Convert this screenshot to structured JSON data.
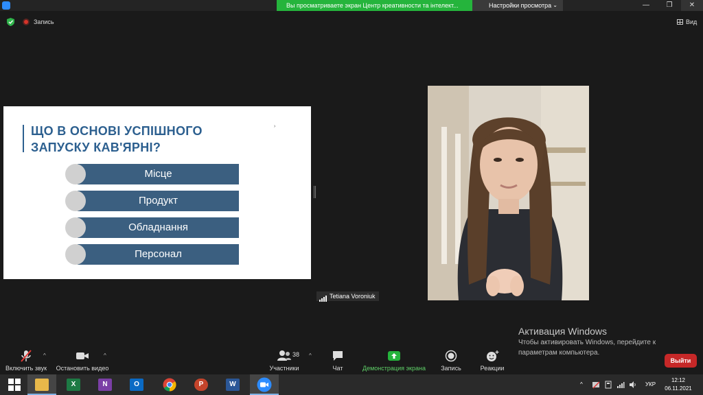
{
  "window": {
    "sharing_banner": "Вы просматриваете экран Центр креативности та інтелект...",
    "view_options_label": "Настройки просмотра",
    "minimize": "—",
    "maximize": "❐",
    "close": "✕"
  },
  "meeting_top": {
    "recording_label": "Запись",
    "view_label": "Вид"
  },
  "slide": {
    "title_line1": "ЩО В ОСНОВІ УСПІШНОГО",
    "title_line2": "ЗАПУСКУ КАВ'ЯРНІ?",
    "arrow": "›",
    "items": [
      "Місце",
      "Продукт",
      "Обладнання",
      "Персонал"
    ]
  },
  "participant": {
    "name": "Tetiana Voroniuk"
  },
  "activation": {
    "title": "Активация Windows",
    "text": "Чтобы активировать Windows, перейдите к параметрам компьютера."
  },
  "controls": {
    "mute_label": "Включить звук",
    "video_label": "Остановить видео",
    "participants_label": "Участники",
    "participants_count": "38",
    "chat_label": "Чат",
    "share_label": "Демонстрация экрана",
    "record_label": "Запись",
    "reactions_label": "Реакции",
    "leave_label": "Выйти",
    "caret": "^"
  },
  "taskbar": {
    "apps": [
      "windows-start",
      "file-explorer",
      "excel",
      "onenote",
      "outlook",
      "chrome",
      "powerpoint",
      "word",
      "zoom"
    ],
    "tile_letters": {
      "excel": "X",
      "onenote": "N",
      "outlook": "O",
      "powerpoint": "P",
      "word": "W"
    },
    "language": "УКР",
    "time": "12:12",
    "date": "06.11.2021",
    "tray_caret": "^"
  },
  "colors": {
    "share_green": "#25b43c",
    "slide_title": "#2c5f8f",
    "slide_bar": "#3b5f80",
    "leave_red": "#c62828"
  }
}
